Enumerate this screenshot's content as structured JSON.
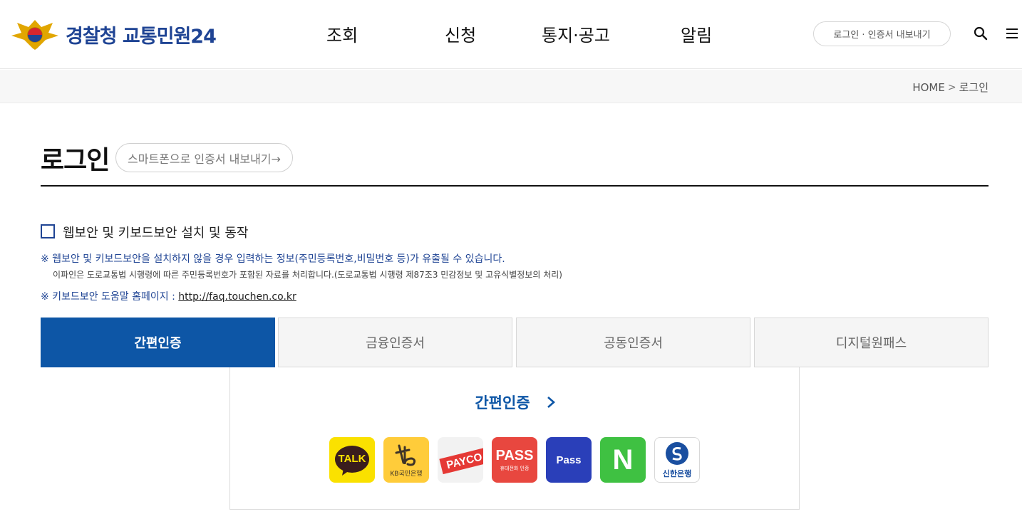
{
  "header": {
    "logo_text": "경찰청 교통민원24",
    "nav": [
      "조회",
      "신청",
      "통지·공고",
      "알림"
    ],
    "login_pill": "로그인 · 인증서 내보내기",
    "icons": [
      "search-icon",
      "menu-icon"
    ]
  },
  "breadcrumb": {
    "home": "HOME",
    "current": "로그인"
  },
  "page": {
    "title": "로그인",
    "export_button": "스마트폰으로 인증서 내보내기→"
  },
  "security": {
    "checkbox_label": "웹보안 및 키보드보안 설치 및 동작",
    "checked": false,
    "notice1": "※ 웹보안 및 키보드보안을 설치하지 않을 경우 입력하는 정보(주민등록번호,비밀번호 등)가 유출될 수 있습니다.",
    "notice2": "이파인은 도로교통법 시행령에 따른 주민등록번호가 포함된 자료를 처리합니다.(도로교통법 시행령 제87조3 민감정보 및 고유식별정보의 처리)",
    "notice3_prefix": "※ 키보드보안 도움말 홈페이지 : ",
    "notice3_link": "http://faq.touchen.co.kr"
  },
  "tabs": [
    {
      "label": "간편인증",
      "active": true
    },
    {
      "label": "금융인증서",
      "active": false
    },
    {
      "label": "공동인증서",
      "active": false
    },
    {
      "label": "디지털원패스",
      "active": false
    }
  ],
  "panel": {
    "title": "간편인증",
    "providers": [
      {
        "name": "kakao",
        "text": "TALK",
        "bg": "#fae100"
      },
      {
        "name": "kb",
        "text": "KB국민은행",
        "bg": "#ffcc3a"
      },
      {
        "name": "payco",
        "text": "PAYCO",
        "bg": "#f2f2f2"
      },
      {
        "name": "pass-sk",
        "text": "PASS",
        "subtext": "휴대전화 인증",
        "bg": "#e8473f"
      },
      {
        "name": "pass-kt",
        "text": "Pass",
        "bg": "#2a3fb9"
      },
      {
        "name": "naver",
        "text": "N",
        "bg": "#3fc142"
      },
      {
        "name": "shinhan",
        "text": "신한은행",
        "bg": "#ffffff"
      }
    ]
  },
  "colors": {
    "primary": "#0d56a6",
    "brand": "#1f4494"
  }
}
